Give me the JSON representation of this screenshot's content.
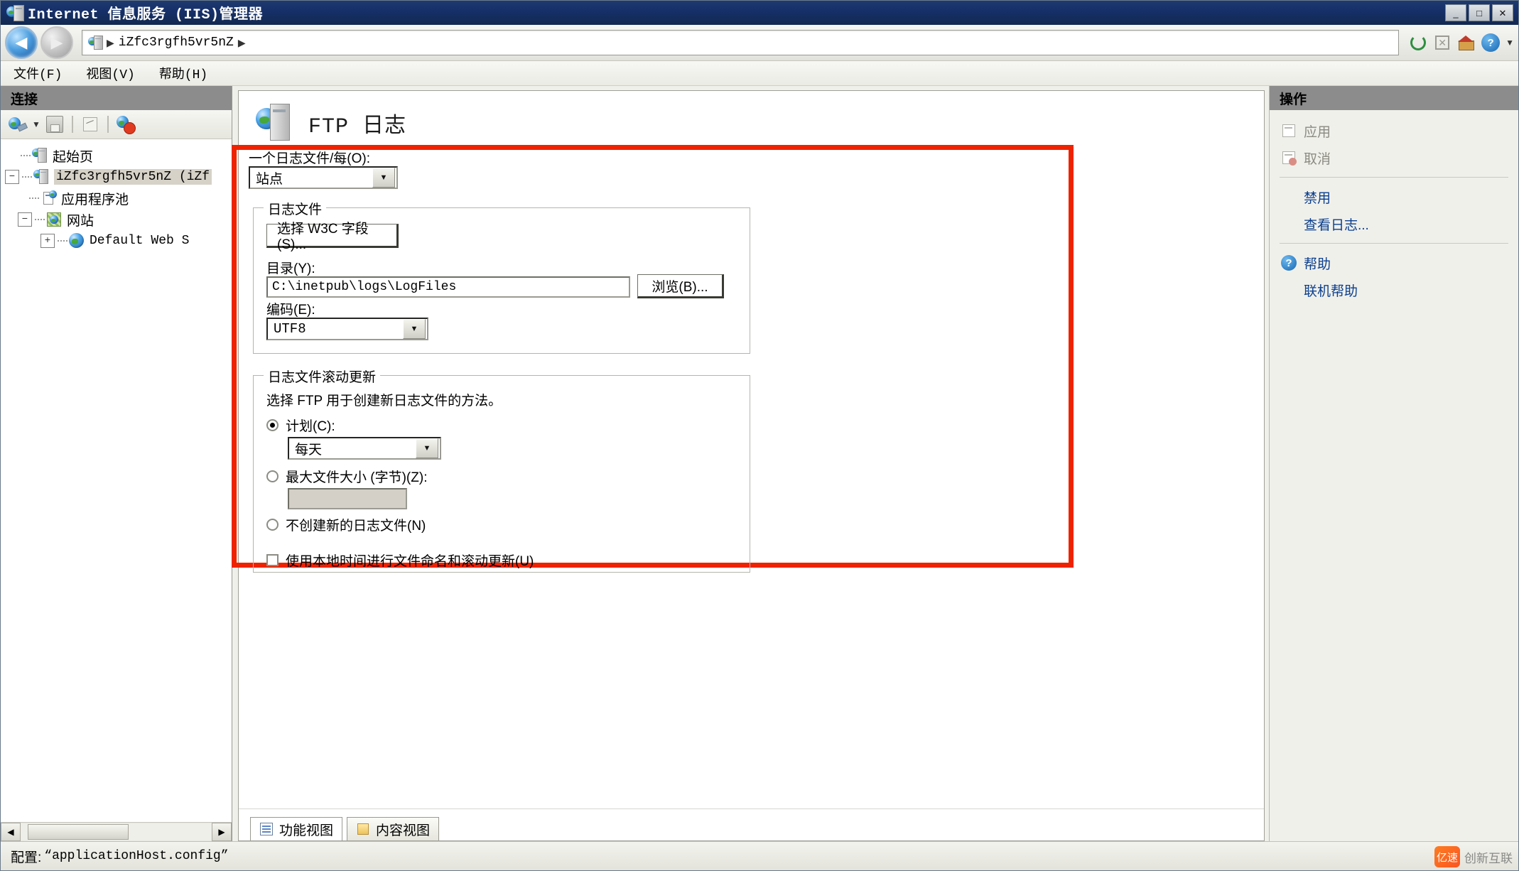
{
  "window": {
    "title": "Internet 信息服务 (IIS)管理器",
    "icon": "iis-server-icon",
    "buttons": {
      "minimize": "_",
      "maximize": "□",
      "close": "✕"
    }
  },
  "address_bar": {
    "back_icon": "back-arrow-icon",
    "forward_icon": "forward-arrow-icon",
    "site_icon": "server-icon",
    "separator": "▶",
    "server_name": "iZfc3rgfh5vr5nZ",
    "trailing_separator": "▶",
    "tools": [
      "refresh-icon",
      "stop-icon",
      "home-icon",
      "help-icon",
      "chevron-down-icon"
    ]
  },
  "menu": {
    "items": [
      {
        "label": "文件(F)"
      },
      {
        "label": "视图(V)"
      },
      {
        "label": "帮助(H)"
      }
    ]
  },
  "connections": {
    "header": "连接",
    "toolbar": [
      {
        "icon": "connect-to-site-icon"
      },
      {
        "icon": "dropdown-arrow-icon"
      },
      {
        "icon": "save-connections-icon"
      },
      {
        "icon": "edit-connection-icon"
      },
      {
        "icon": "remove-connection-icon"
      }
    ],
    "tree": [
      {
        "label": "起始页",
        "icon": "start-page-icon",
        "depth": 0,
        "expander": "",
        "selected": false,
        "cjk": true
      },
      {
        "label": "iZfc3rgfh5vr5nZ (iZf",
        "icon": "server-node-icon",
        "depth": 0,
        "expander": "−",
        "selected": true,
        "cjk": false
      },
      {
        "label": "应用程序池",
        "icon": "app-pools-icon",
        "depth": 1,
        "expander": "",
        "selected": false,
        "cjk": true
      },
      {
        "label": "网站",
        "icon": "sites-icon",
        "depth": 1,
        "expander": "−",
        "selected": false,
        "cjk": true
      },
      {
        "label": "Default Web S",
        "icon": "website-icon",
        "depth": 2,
        "expander": "+",
        "selected": false,
        "cjk": false
      }
    ]
  },
  "page": {
    "icon": "ftp-logging-icon",
    "title": "FTP 日志",
    "one_log_file_label": "一个日志文件/每(O):",
    "one_log_file_value": "站点",
    "log_file_group": {
      "legend": "日志文件",
      "select_fields_button": "选择 W3C 字段(S)...",
      "directory_label": "目录(Y):",
      "directory_value": "C:\\inetpub\\logs\\LogFiles",
      "browse_button": "浏览(B)...",
      "encoding_label": "编码(E):",
      "encoding_value": "UTF8"
    },
    "rollover_group": {
      "legend": "日志文件滚动更新",
      "description": "选择 FTP 用于创建新日志文件的方法。",
      "schedule_option": "计划(C):",
      "schedule_selected": true,
      "schedule_value": "每天",
      "maxsize_option": "最大文件大小 (字节)(Z):",
      "maxsize_selected": false,
      "maxsize_value": "",
      "nonew_option": "不创建新的日志文件(N)",
      "nonew_selected": false,
      "localtime_checkbox": "使用本地时间进行文件命名和滚动更新(U)",
      "localtime_checked": false
    }
  },
  "view_tabs": [
    {
      "label": "功能视图",
      "icon": "features-view-icon",
      "active": true
    },
    {
      "label": "内容视图",
      "icon": "content-view-icon",
      "active": false
    }
  ],
  "actions": {
    "header": "操作",
    "items": [
      {
        "label": "应用",
        "icon": "apply-icon",
        "disabled": true,
        "link": false,
        "separator_after": false
      },
      {
        "label": "取消",
        "icon": "cancel-icon",
        "disabled": true,
        "link": false,
        "separator_after": true
      },
      {
        "label": "禁用",
        "icon": "",
        "disabled": false,
        "link": true,
        "separator_after": false
      },
      {
        "label": "查看日志...",
        "icon": "",
        "disabled": false,
        "link": true,
        "separator_after": true
      },
      {
        "label": "帮助",
        "icon": "help-icon",
        "disabled": false,
        "link": true,
        "separator_after": false
      },
      {
        "label": "联机帮助",
        "icon": "",
        "disabled": false,
        "link": true,
        "separator_after": false
      }
    ]
  },
  "status_bar": {
    "config_label": "配置:",
    "config_path": "“applicationHost.config”"
  },
  "watermark": {
    "text": "创新互联",
    "badge": "亿速"
  },
  "colors": {
    "titlebar": "#16306a",
    "highlight_border": "#ef2200",
    "link": "#0a3f8f",
    "panel_header": "#8c8c8c"
  }
}
